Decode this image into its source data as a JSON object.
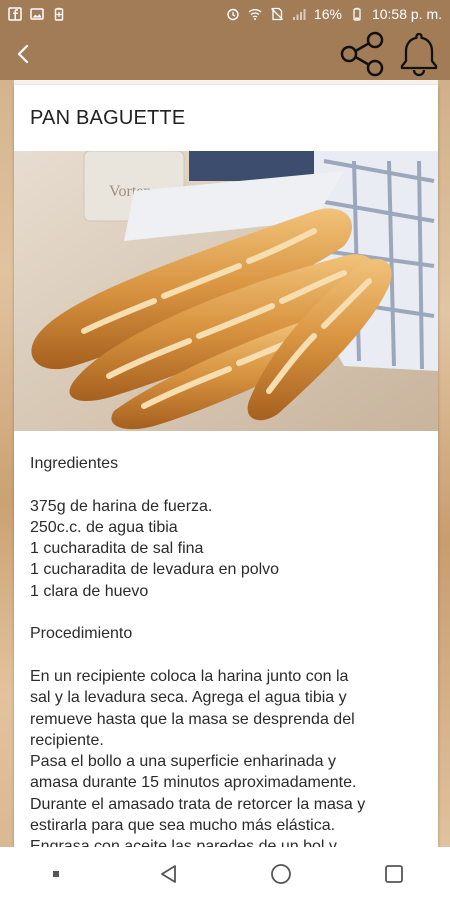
{
  "status_bar": {
    "battery_percent": "16%",
    "time": "10:58 p. m."
  },
  "recipe": {
    "title": "PAN BAGUETTE",
    "ingredients_heading": "Ingredientes",
    "ingredients": [
      "375g de harina de fuerza.",
      "250c.c. de agua tibia",
      "1 cucharadita de sal fina",
      "1 cucharadita de levadura en polvo",
      "1 clara de huevo"
    ],
    "procedure_heading": "Procedimiento",
    "procedure_lines": [
      "En un recipiente coloca la harina junto con la",
      "sal y la levadura seca. Agrega el agua tibia y",
      "remueve hasta que la masa se desprenda del",
      "recipiente.",
      "Pasa el bollo a una superficie enharinada y",
      "amasa durante 15 minutos aproximadamente.",
      "Durante el amasado trata de retorcer la masa y",
      "estirarla para que sea mucho más elástica.",
      "Engrasa con aceite las paredes de un bol y"
    ],
    "image_label": "Vorten"
  },
  "icons": {
    "back": "arrow-back-icon",
    "share": "share-icon",
    "bell": "bell-icon"
  },
  "colors": {
    "bar": "#a27c57",
    "card": "#ffffff",
    "text": "#2b2b2b"
  }
}
